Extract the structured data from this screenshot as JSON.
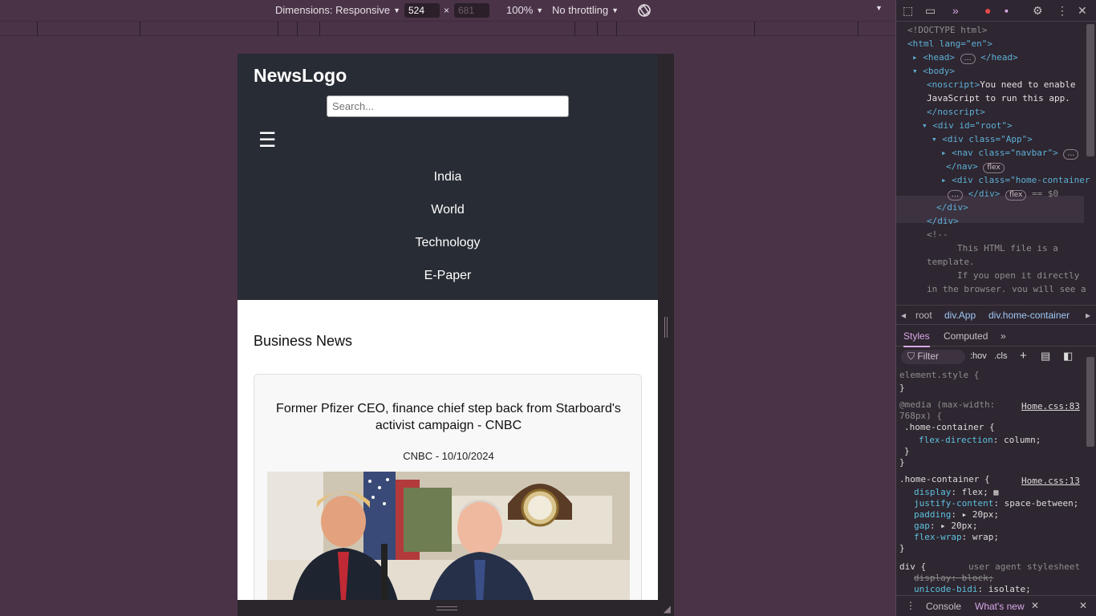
{
  "toolbar": {
    "dimensions_label": "Dimensions: Responsive",
    "width_value": "524",
    "height_placeholder": "681",
    "times": "×",
    "zoom": "100%",
    "throttle": "No throttling"
  },
  "site": {
    "logo": "NewsLogo",
    "search_placeholder": "Search...",
    "menu_icon": "☰",
    "nav": [
      "India",
      "World",
      "Technology",
      "E-Paper"
    ],
    "section_title": "Business News",
    "article": {
      "title": "Former Pfizer CEO, finance chief step back from Starboard's activist campaign - CNBC",
      "meta": "CNBC - 10/10/2024"
    }
  },
  "devtools": {
    "elements": [
      "<!DOCTYPE html>",
      "<html lang=\"en\">",
      "<head>",
      "</head>",
      "<body>",
      "<noscript>You need to enable",
      "JavaScript to run this app.",
      "</noscript>",
      "<div id=\"root\">",
      "<div class=\"App\">",
      "<nav class=\"navbar\">",
      "</nav>",
      "<div class=\"home-container",
      "</div>",
      "== $0",
      "</div>",
      "</div>",
      "<!--",
      "This HTML file is a",
      "template.",
      "If you open it directly",
      "in the browser, you will see a"
    ],
    "pill_flex": "flex",
    "breadcrumbs": [
      "root",
      "div.App",
      "div.home-container"
    ],
    "tabs": [
      "Styles",
      "Computed"
    ],
    "filter_placeholder": "Filter",
    "hov": ":hov",
    "cls": ".cls",
    "styles": {
      "element_style": "element.style {",
      "close": "}",
      "media": "@media (max-width:",
      "media2": "768px) {",
      "media_link": "Home.css:83",
      "hc_selector": ".home-container {",
      "flex_direction": "flex-direction",
      "column": "column;",
      "hc_link": "Home.css:13",
      "display": "display",
      "flex_val": "flex;",
      "justify": "justify-content",
      "space_between": "space-between;",
      "padding": "padding",
      "gap": "gap",
      "px20": "20px;",
      "flex_wrap": "flex-wrap",
      "wrap": "wrap;",
      "div_sel": "div {",
      "user_agent": "user agent stylesheet",
      "display_block": "display: block;",
      "unicode_bidi": "unicode-bidi",
      "isolate": "isolate;"
    },
    "drawer": [
      "Console",
      "What's new"
    ]
  }
}
